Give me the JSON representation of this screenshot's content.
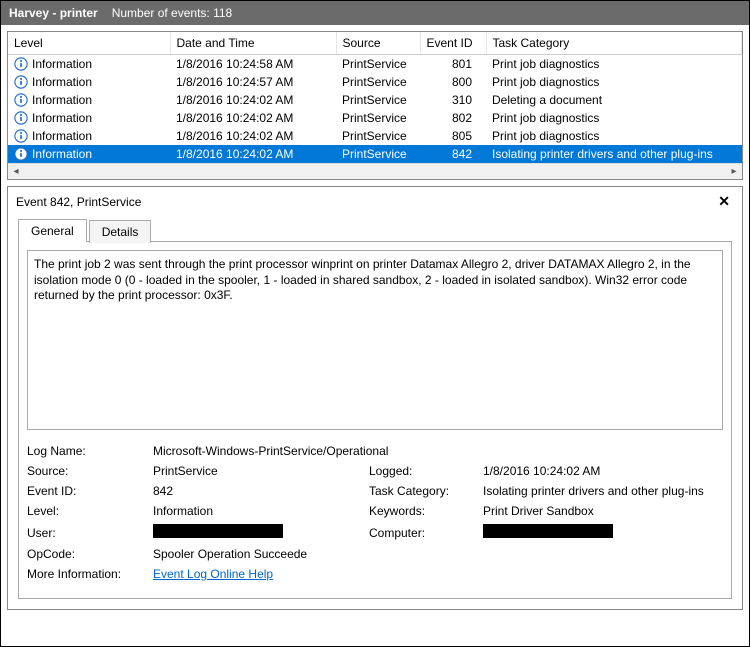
{
  "titlebar": {
    "title": "Harvey - printer",
    "events_count_label": "Number of events: 118"
  },
  "grid": {
    "headers": {
      "level": "Level",
      "date": "Date and Time",
      "source": "Source",
      "eid": "Event ID",
      "task": "Task Category"
    },
    "rows": [
      {
        "level": "Information",
        "date": "1/8/2016 10:24:58 AM",
        "source": "PrintService",
        "eid": "801",
        "task": "Print job diagnostics",
        "selected": false
      },
      {
        "level": "Information",
        "date": "1/8/2016 10:24:57 AM",
        "source": "PrintService",
        "eid": "800",
        "task": "Print job diagnostics",
        "selected": false
      },
      {
        "level": "Information",
        "date": "1/8/2016 10:24:02 AM",
        "source": "PrintService",
        "eid": "310",
        "task": "Deleting a document",
        "selected": false
      },
      {
        "level": "Information",
        "date": "1/8/2016 10:24:02 AM",
        "source": "PrintService",
        "eid": "802",
        "task": "Print job diagnostics",
        "selected": false
      },
      {
        "level": "Information",
        "date": "1/8/2016 10:24:02 AM",
        "source": "PrintService",
        "eid": "805",
        "task": "Print job diagnostics",
        "selected": false
      },
      {
        "level": "Information",
        "date": "1/8/2016 10:24:02 AM",
        "source": "PrintService",
        "eid": "842",
        "task": "Isolating printer drivers and other plug-ins",
        "selected": true
      }
    ]
  },
  "detail": {
    "header": "Event 842, PrintService",
    "close": "✕",
    "tabs": {
      "general": "General",
      "details": "Details"
    },
    "description": "The print job 2 was sent through the print processor winprint on printer Datamax Allegro 2, driver DATAMAX Allegro 2, in the isolation mode 0 (0 - loaded in the spooler, 1 - loaded in shared sandbox, 2 - loaded in isolated sandbox). Win32 error code returned by the print processor: 0x3F.",
    "labels": {
      "logname": "Log Name:",
      "source": "Source:",
      "eventid": "Event ID:",
      "level": "Level:",
      "user": "User:",
      "opcode": "OpCode:",
      "moreinfo": "More Information:",
      "logged": "Logged:",
      "taskcat": "Task Category:",
      "keywords": "Keywords:",
      "computer": "Computer:"
    },
    "values": {
      "logname": "Microsoft-Windows-PrintService/Operational",
      "source": "PrintService",
      "eventid": "842",
      "level": "Information",
      "opcode": "Spooler Operation Succeede",
      "moreinfo_link": "Event Log Online Help",
      "logged": "1/8/2016 10:24:02 AM",
      "taskcat": "Isolating printer drivers and other plug-ins",
      "keywords": "Print Driver Sandbox"
    }
  }
}
